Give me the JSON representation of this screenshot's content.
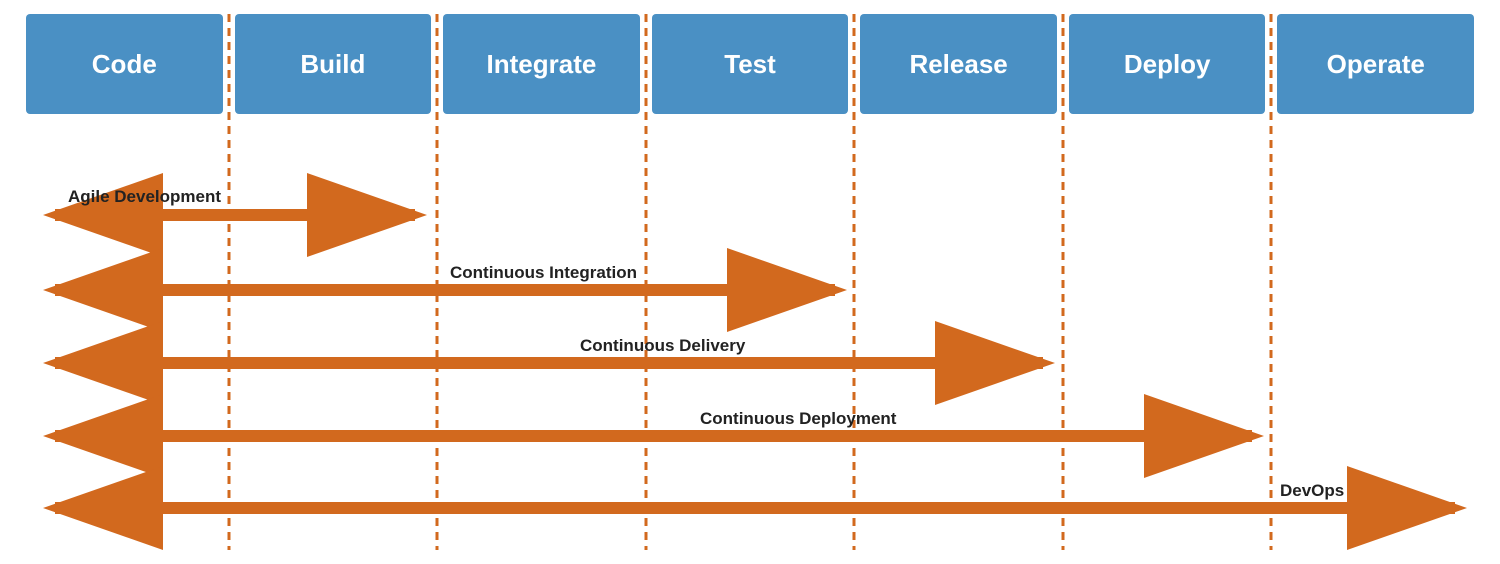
{
  "phases": [
    {
      "id": "code",
      "label": "Code"
    },
    {
      "id": "build",
      "label": "Build"
    },
    {
      "id": "integrate",
      "label": "Integrate"
    },
    {
      "id": "test",
      "label": "Test"
    },
    {
      "id": "release",
      "label": "Release"
    },
    {
      "id": "deploy",
      "label": "Deploy"
    },
    {
      "id": "operate",
      "label": "Operate"
    }
  ],
  "arrows": [
    {
      "id": "agile",
      "label": "Agile Development",
      "labelRight": false
    },
    {
      "id": "ci",
      "label": "Continuous Integration",
      "labelRight": false
    },
    {
      "id": "cd",
      "label": "Continuous Delivery",
      "labelRight": false
    },
    {
      "id": "cdeploy",
      "label": "Continuous Deployment",
      "labelRight": false
    },
    {
      "id": "devops",
      "label": "DevOps",
      "labelRight": false
    }
  ],
  "colors": {
    "box_bg": "#4a90c4",
    "box_text": "#ffffff",
    "arrow_color": "#d2691e",
    "dashed_color": "#d2691e",
    "label_color": "#222222"
  }
}
